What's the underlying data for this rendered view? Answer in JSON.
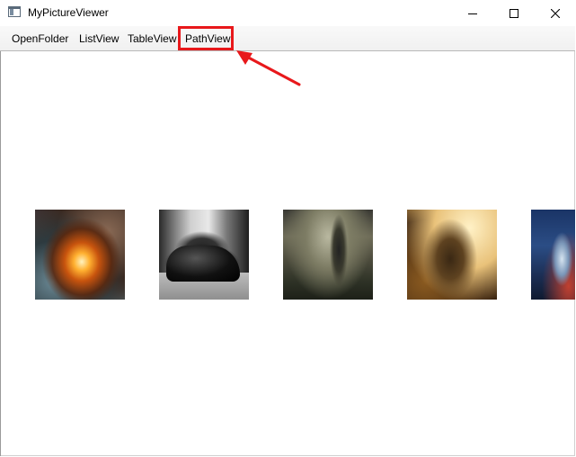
{
  "window": {
    "title": "MyPictureViewer",
    "controls": [
      "minimize-icon",
      "maximize-icon",
      "close-icon"
    ]
  },
  "menu": {
    "items": [
      {
        "label": "OpenFolder"
      },
      {
        "label": "ListView"
      },
      {
        "label": "TableView"
      },
      {
        "label": "PathView",
        "highlighted": true
      }
    ],
    "highlight_color": "#e8181b"
  },
  "path_view": {
    "thumbnails": [
      {
        "subject": "fiery explosion over stormy sea"
      },
      {
        "subject": "black sports car on a street"
      },
      {
        "subject": "dark ruins landscape with a figure"
      },
      {
        "subject": "golden winged warrior"
      },
      {
        "subject": "night city street with a tram"
      }
    ]
  }
}
